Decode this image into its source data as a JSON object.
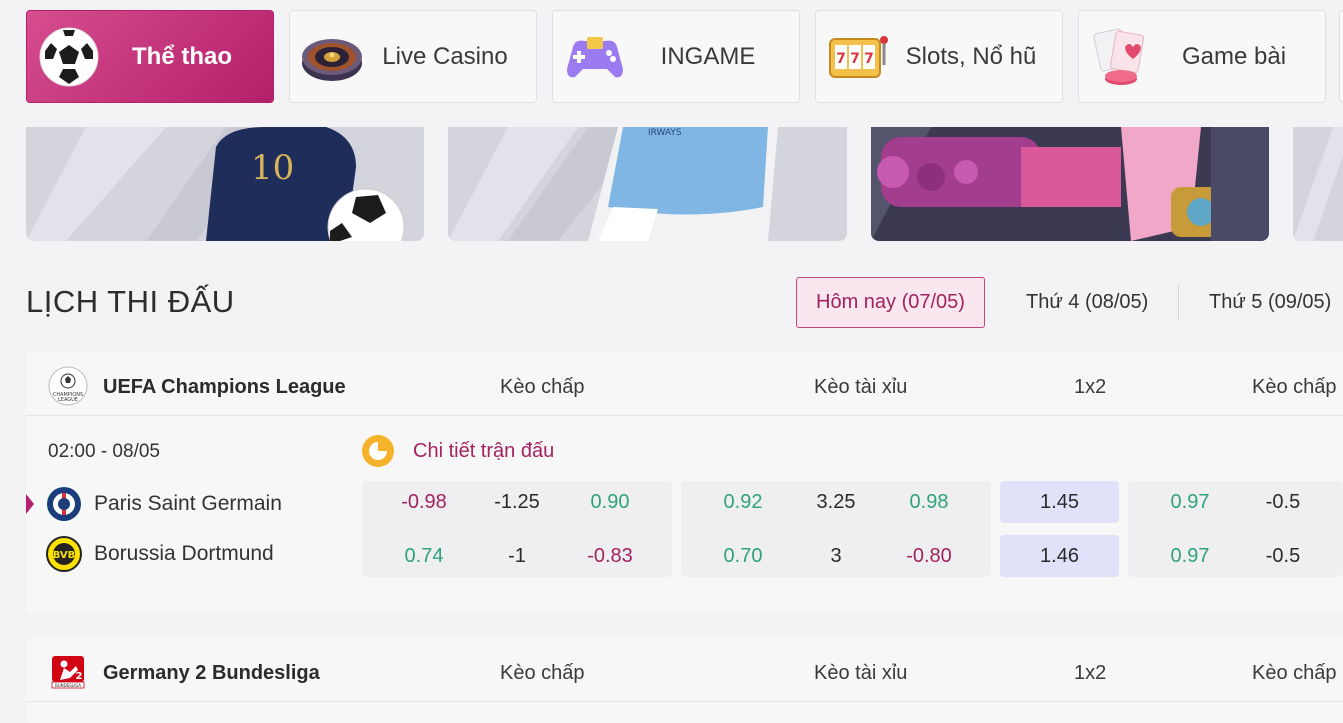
{
  "categories": [
    {
      "label": "Thể thao",
      "icon": "soccer-ball-icon",
      "active": true
    },
    {
      "label": "Live Casino",
      "icon": "roulette-icon",
      "active": false
    },
    {
      "label": "INGAME",
      "icon": "gamepad-icon",
      "active": false
    },
    {
      "label": "Slots, Nổ hũ",
      "icon": "slot-machine-icon",
      "active": false
    },
    {
      "label": "Game bài",
      "icon": "playing-cards-icon",
      "active": false
    }
  ],
  "schedule": {
    "title": "LỊCH THI ĐẤU",
    "dates": [
      "Hôm nay (07/05)",
      "Thứ 4 (08/05)",
      "Thứ 5 (09/05)"
    ],
    "active_date": 0
  },
  "columns": {
    "handicap": "Kèo chấp",
    "overunder": "Kèo tài xỉu",
    "onextwo": "1x2",
    "handicap2": "Kèo chấp"
  },
  "leagues": [
    {
      "name": "UEFA Champions League",
      "logo": "champions-league-logo",
      "match": {
        "time": "02:00 - 08/05",
        "detail_label": "Chi tiết trận đấu",
        "home": {
          "name": "Paris Saint Germain",
          "logo": "psg-logo",
          "handicap": [
            "-0.98",
            "-1.25",
            "0.90"
          ],
          "overunder": [
            "0.92",
            "3.25",
            "0.98"
          ],
          "onextwo": "1.45",
          "handicap2": [
            "0.97",
            "-0.5"
          ]
        },
        "away": {
          "name": "Borussia Dortmund",
          "logo": "bvb-logo",
          "handicap": [
            "0.74",
            "-1",
            "-0.83"
          ],
          "overunder": [
            "0.70",
            "3",
            "-0.80"
          ],
          "onextwo": "1.46",
          "handicap2": [
            "0.97",
            "-0.5"
          ]
        }
      }
    },
    {
      "name": "Germany 2 Bundesliga",
      "logo": "bundesliga-2-logo"
    }
  ],
  "colors": {
    "brand": "#b41f6a",
    "positive": "#2fa37a",
    "negative": "#a3235f",
    "highlight": "#e1e2fa"
  }
}
